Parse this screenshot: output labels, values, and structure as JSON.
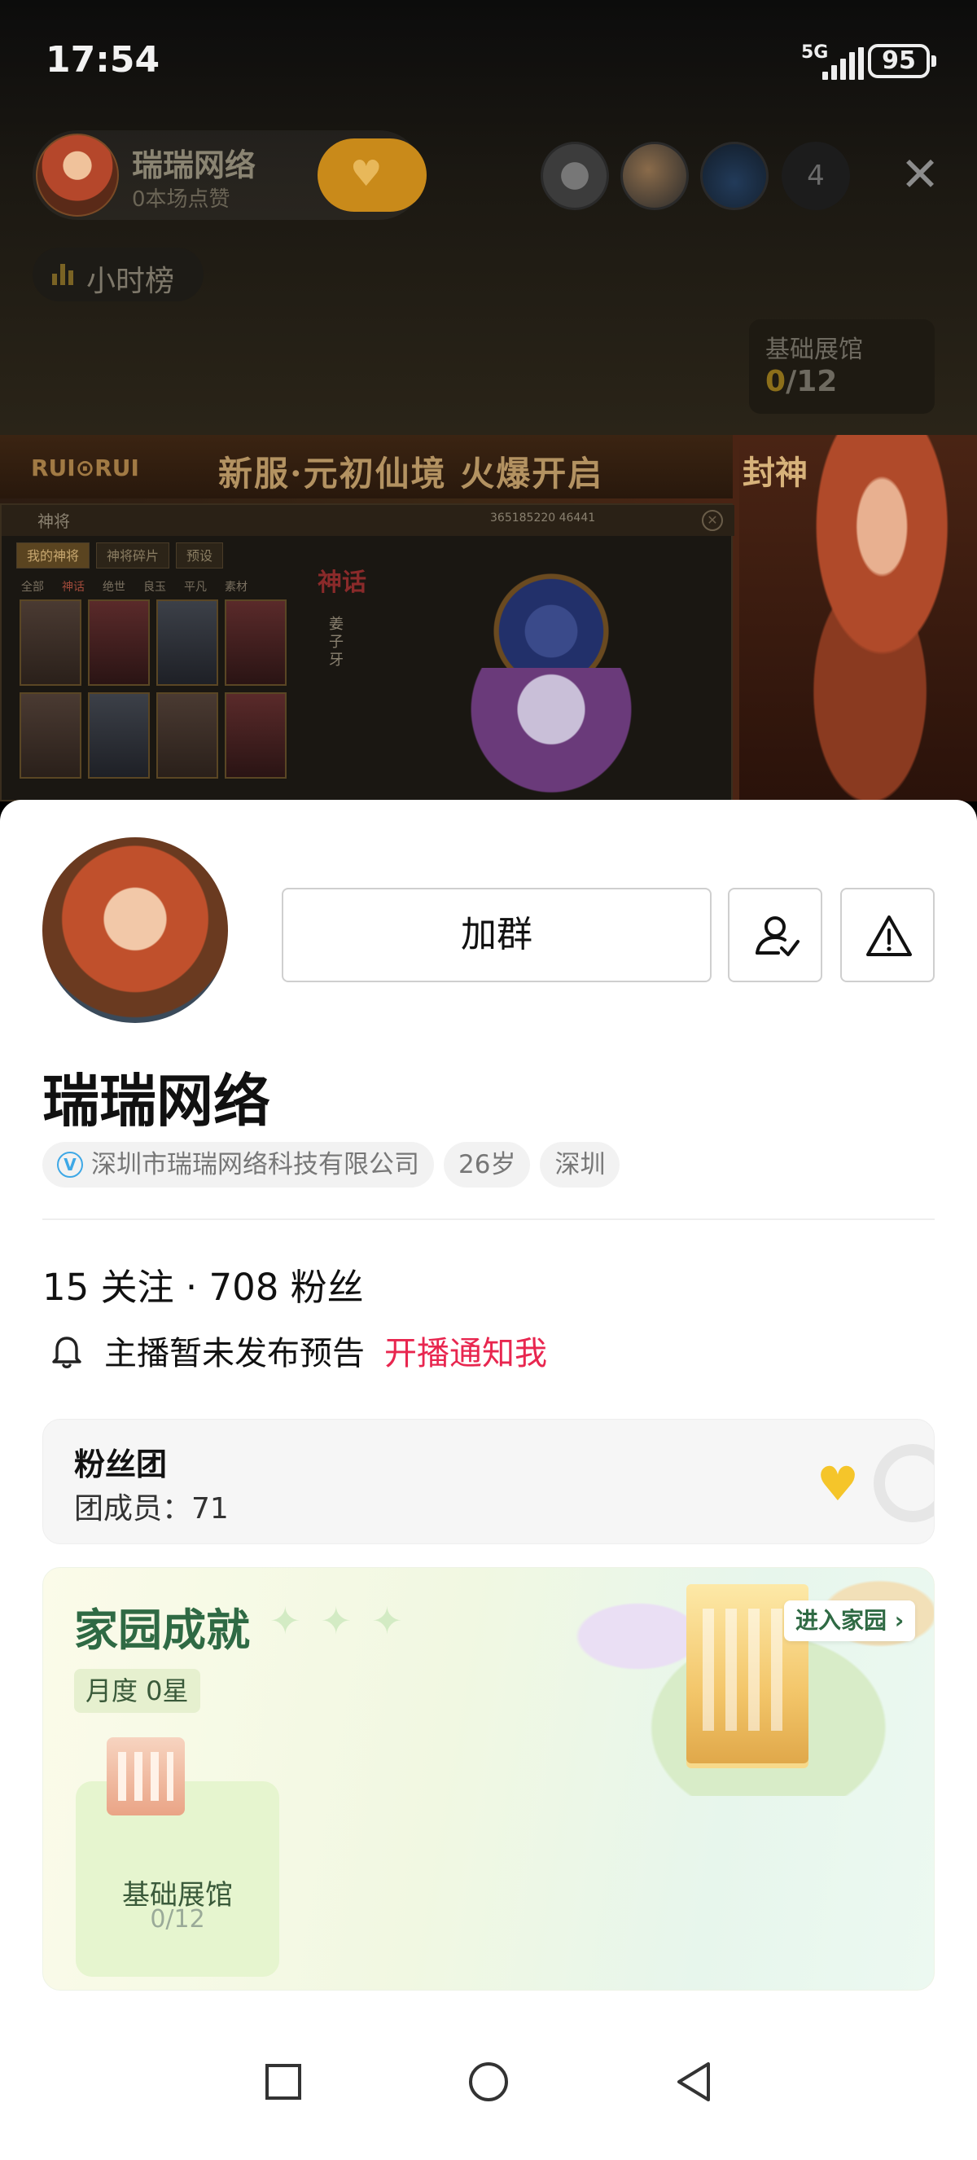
{
  "status_bar": {
    "time": "17:54",
    "network": "5G",
    "battery": "95"
  },
  "live_room": {
    "host_name": "瑞瑞网络",
    "host_likes": "0本场点赞",
    "viewer_count": "4",
    "rank_label": "小时榜",
    "museum": {
      "title": "基础展馆",
      "current": "0",
      "total": "/12"
    },
    "banner": {
      "logo": "RUI⊙RUI",
      "title": "新服·元初仙境 火爆开启",
      "panel_title": "神将",
      "panel_stats": "365185220    46441",
      "tabs": [
        "我的神将",
        "神将碎片",
        "预设"
      ],
      "filters": [
        "全部",
        "神话",
        "绝世",
        "良玉",
        "平凡",
        "素材"
      ],
      "side_tag": "神话",
      "side_name": "姜子牙",
      "side_mark": "封神"
    }
  },
  "profile": {
    "join_button": "加群",
    "name": "瑞瑞网络",
    "tags": {
      "company": "深圳市瑞瑞网络科技有限公司",
      "age": "26岁",
      "city": "深圳"
    },
    "verified_mark": "V",
    "stats": "15 关注 · 708 粉丝",
    "notice_text": "主播暂未发布预告",
    "notice_link": "开播通知我",
    "fans_club": {
      "title": "粉丝团",
      "members": "团成员：71"
    },
    "home": {
      "title": "家园成就",
      "month": "月度 0星",
      "enter": "进入家园",
      "building_name": "基础展馆",
      "building_progress": "0/12"
    }
  },
  "colors": {
    "accent_red": "#e8264f",
    "home_green": "#2f6a44",
    "gold": "#f5c52a"
  }
}
